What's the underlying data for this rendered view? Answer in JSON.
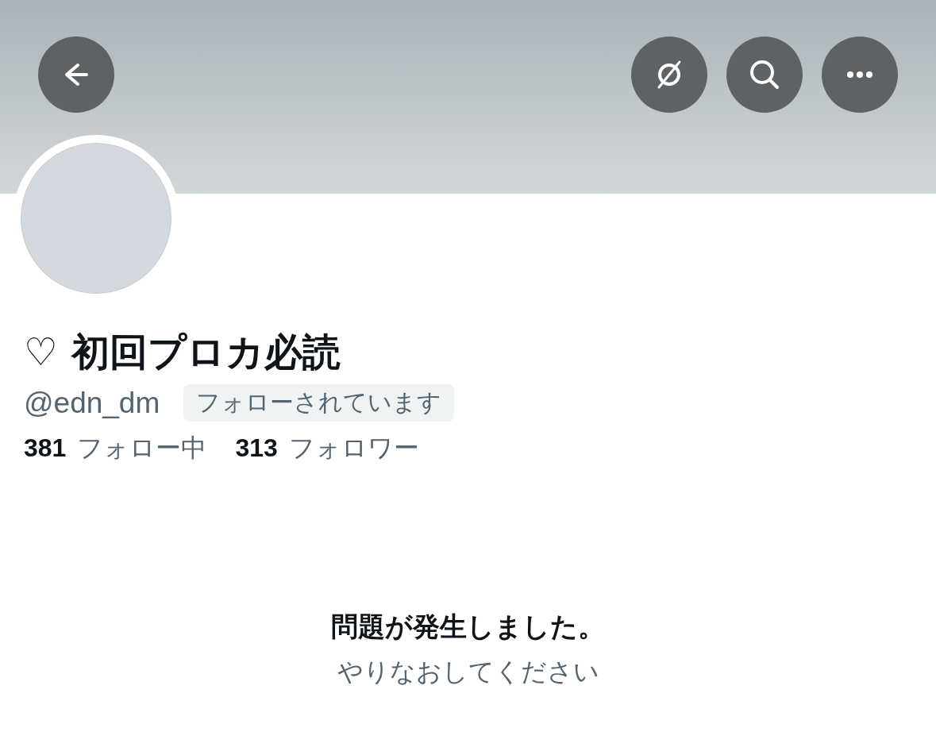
{
  "header": {
    "buttons": [
      {
        "kind": "back"
      },
      {
        "kind": "slashed-circle"
      },
      {
        "kind": "search"
      },
      {
        "kind": "more"
      }
    ]
  },
  "profile": {
    "display_name": "♡ 初回プロカ必読",
    "handle": "@edn_dm",
    "follows_you_badge": "フォローされています",
    "stats": [
      {
        "count": "381",
        "label": "フォロー中"
      },
      {
        "count": "313",
        "label": "フォロワー"
      }
    ]
  },
  "error": {
    "title": "問題が発生しました。",
    "subtitle": "やりなおしてください"
  }
}
